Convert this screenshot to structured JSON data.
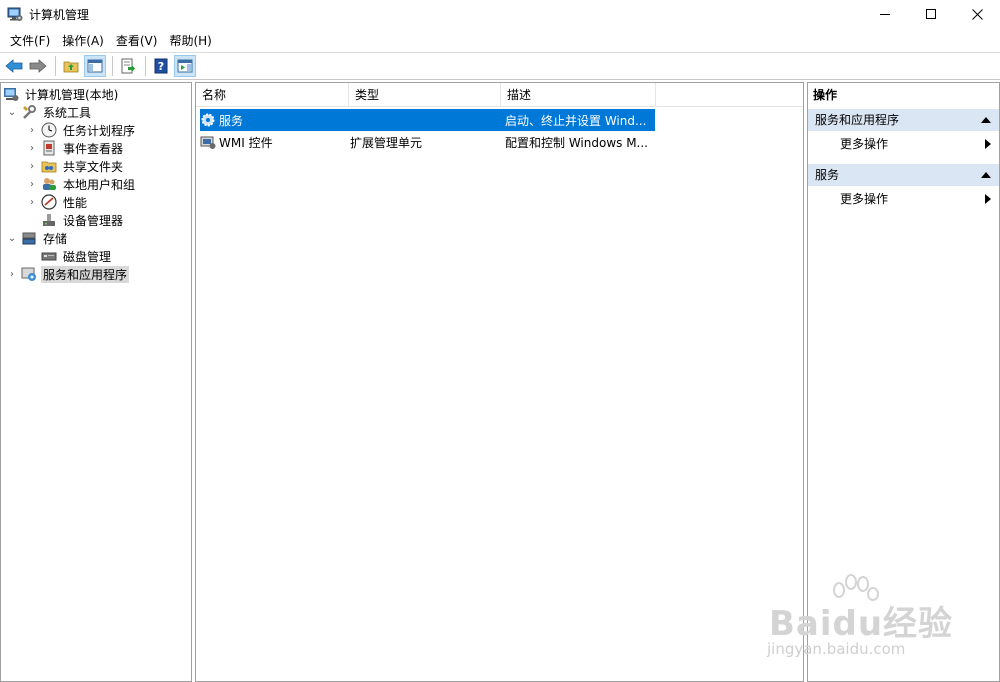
{
  "window": {
    "title": "计算机管理",
    "minimize_icon": "minimize-icon",
    "maximize_icon": "maximize-icon",
    "close_icon": "close-icon"
  },
  "menu": [
    "文件(F)",
    "操作(A)",
    "查看(V)",
    "帮助(H)"
  ],
  "toolbar": [
    "back-arrow-icon",
    "forward-arrow-icon",
    "up-folder-icon",
    "show-hide-tree-icon",
    "export-list-icon",
    "help-icon",
    "show-hide-action-pane-icon"
  ],
  "tree": {
    "root": "计算机管理(本地)",
    "system_tools": "系统工具",
    "task_scheduler": "任务计划程序",
    "event_viewer": "事件查看器",
    "shared_folders": "共享文件夹",
    "local_users": "本地用户和组",
    "performance": "性能",
    "device_manager": "设备管理器",
    "storage": "存储",
    "disk_management": "磁盘管理",
    "services_apps": "服务和应用程序"
  },
  "list": {
    "columns": [
      "名称",
      "类型",
      "描述"
    ],
    "rows": [
      {
        "name": "服务",
        "type": "",
        "desc": "启动、终止并设置 Wind...",
        "icon": "services-gear-icon"
      },
      {
        "name": "WMI 控件",
        "type": "扩展管理单元",
        "desc": "配置和控制 Windows M...",
        "icon": "wmi-control-icon"
      }
    ]
  },
  "actions": {
    "title": "操作",
    "section1": "服务和应用程序",
    "section1_more": "更多操作",
    "section2": "服务",
    "section2_more": "更多操作"
  },
  "watermark": {
    "brand": "Baidu经验",
    "url": "jingyan.baidu.com"
  },
  "colors": {
    "selection": "#0078d7",
    "section_header": "#dbe6f4",
    "tree_selected": "#d9d9d9"
  }
}
